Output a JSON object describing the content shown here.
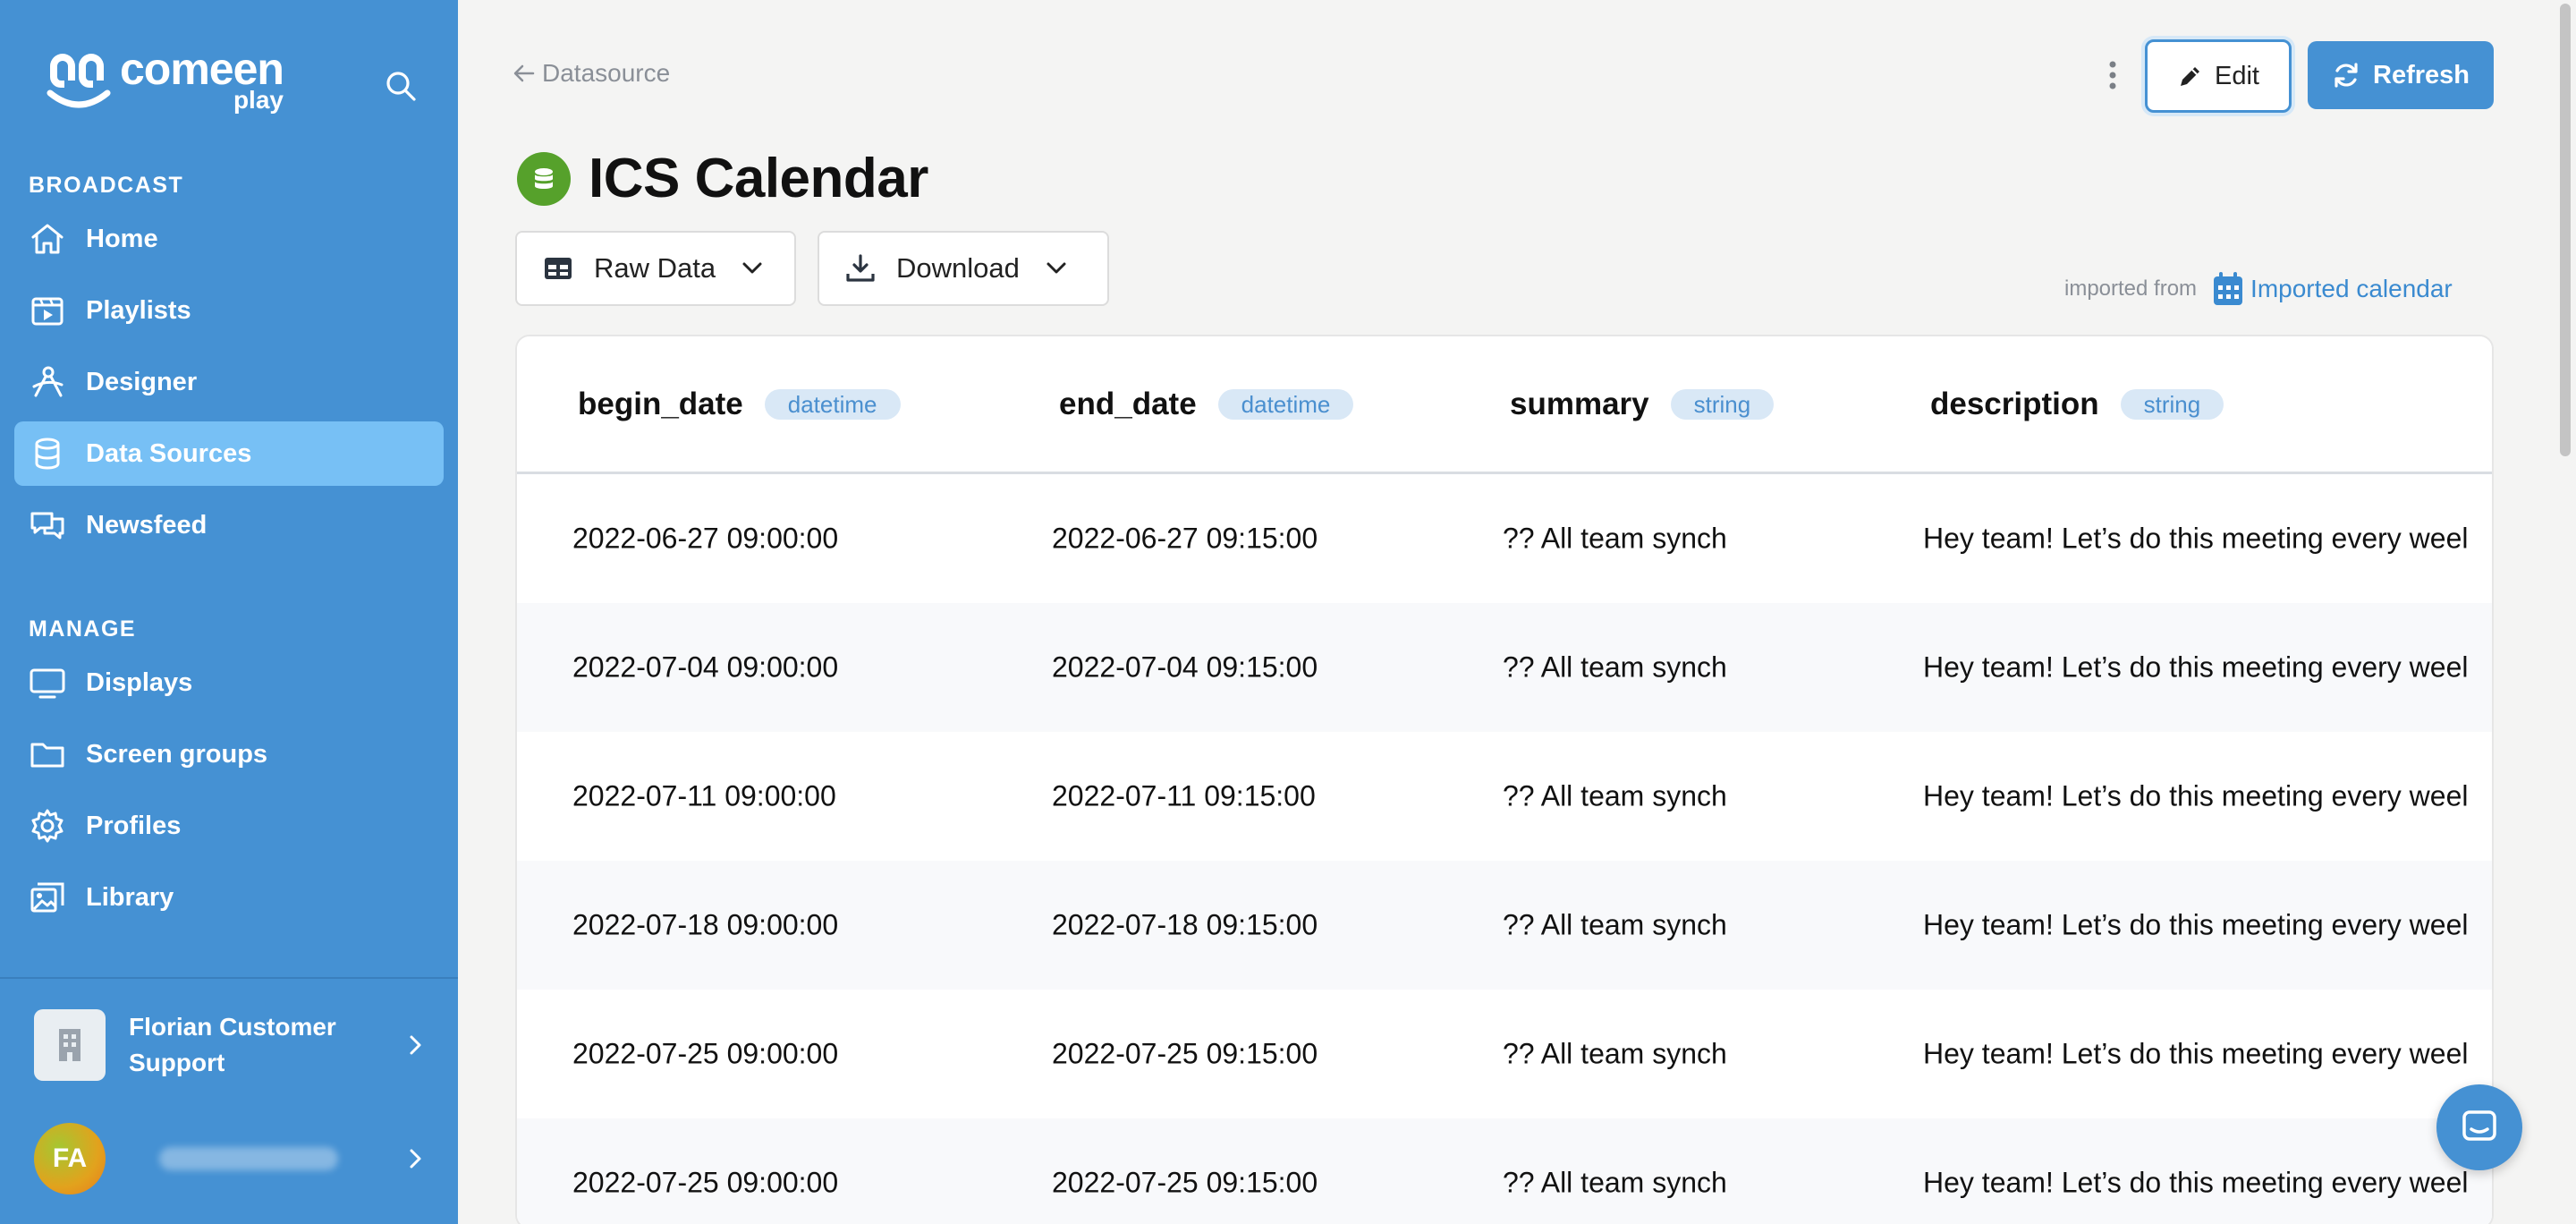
{
  "app": {
    "logo_name": "comeen",
    "logo_sub": "play"
  },
  "sidebar": {
    "sections": [
      {
        "title": "BROADCAST"
      },
      {
        "title": "MANAGE"
      }
    ],
    "broadcast_items": [
      {
        "label": "Home",
        "icon": "home-icon"
      },
      {
        "label": "Playlists",
        "icon": "playlist-icon"
      },
      {
        "label": "Designer",
        "icon": "designer-icon"
      },
      {
        "label": "Data Sources",
        "icon": "database-icon",
        "active": true
      },
      {
        "label": "Newsfeed",
        "icon": "newsfeed-icon"
      }
    ],
    "manage_items": [
      {
        "label": "Displays",
        "icon": "display-icon"
      },
      {
        "label": "Screen groups",
        "icon": "folder-icon"
      },
      {
        "label": "Profiles",
        "icon": "gear-icon"
      },
      {
        "label": "Library",
        "icon": "library-icon"
      }
    ],
    "organization": "Florian Customer Support",
    "user_initials": "FA"
  },
  "header": {
    "back_label": "Datasource",
    "edit_label": "Edit",
    "refresh_label": "Refresh"
  },
  "page": {
    "title": "ICS Calendar",
    "view_dropdown": "Raw Data",
    "download_dropdown": "Download",
    "imported_from_label": "imported from",
    "imported_source": "Imported calendar"
  },
  "table": {
    "columns": [
      {
        "name": "begin_date",
        "type": "datetime"
      },
      {
        "name": "end_date",
        "type": "datetime"
      },
      {
        "name": "summary",
        "type": "string"
      },
      {
        "name": "description",
        "type": "string"
      }
    ],
    "rows": [
      [
        "2022-06-27 09:00:00",
        "2022-06-27 09:15:00",
        "?? All team synch",
        "Hey team! Let’s do this meeting every weel"
      ],
      [
        "2022-07-04 09:00:00",
        "2022-07-04 09:15:00",
        "?? All team synch",
        "Hey team! Let’s do this meeting every weel"
      ],
      [
        "2022-07-11 09:00:00",
        "2022-07-11 09:15:00",
        "?? All team synch",
        "Hey team! Let’s do this meeting every weel"
      ],
      [
        "2022-07-18 09:00:00",
        "2022-07-18 09:15:00",
        "?? All team synch",
        "Hey team! Let’s do this meeting every weel"
      ],
      [
        "2022-07-25 09:00:00",
        "2022-07-25 09:15:00",
        "?? All team synch",
        "Hey team! Let’s do this meeting every weel"
      ],
      [
        "2022-07-25 09:00:00",
        "2022-07-25 09:15:00",
        "?? All team synch",
        "Hey team! Let’s do this meeting every weel"
      ]
    ]
  },
  "colors": {
    "sidebar": "#4591d3",
    "sidebar_active": "#77c0f5",
    "accent": "#4591d3",
    "datasource_badge": "#56a12b",
    "type_pill_bg": "#d9e8f6",
    "type_pill_text": "#4a8fcf"
  }
}
